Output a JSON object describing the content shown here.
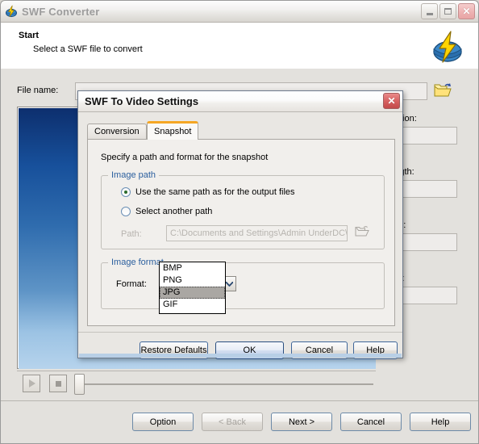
{
  "window": {
    "title": "SWF Converter",
    "icon": "app-lightning-icon",
    "controls": {
      "minimize": "–",
      "maximize": "□",
      "close": "✕"
    }
  },
  "header": {
    "title": "Start",
    "subtitle": "Select a SWF file to convert",
    "logo": "swf-converter-logo"
  },
  "main": {
    "file_name_label": "File name:",
    "file_name_value": "",
    "browse_icon": "open-folder-icon",
    "fields": [
      {
        "label": "Version:",
        "value": ""
      },
      {
        "label": "Length:",
        "value": ""
      },
      {
        "label": "Rate:",
        "value": ""
      },
      {
        "label": "Size:",
        "value": ""
      }
    ],
    "transport": {
      "play": "play-icon",
      "stop": "stop-icon",
      "seek_position": 0
    }
  },
  "footer": {
    "buttons": [
      {
        "label": "Option",
        "accesskey": "O",
        "disabled": false
      },
      {
        "label": "< Back",
        "accesskey": "B",
        "disabled": true
      },
      {
        "label": "Next >",
        "accesskey": "N",
        "disabled": false
      },
      {
        "label": "Cancel",
        "accesskey": "",
        "disabled": false
      },
      {
        "label": "Help",
        "accesskey": "",
        "disabled": false
      }
    ]
  },
  "dialog": {
    "title": "SWF To Video Settings",
    "close_glyph": "✕",
    "tabs": [
      {
        "label": "Conversion",
        "active": false
      },
      {
        "label": "Snapshot",
        "active": true
      }
    ],
    "note": "Specify a path and format for the snapshot",
    "image_path_group": {
      "legend": "Image path",
      "options": [
        {
          "label": "Use the same path as for the output files",
          "selected": true
        },
        {
          "label": "Select another path",
          "selected": false
        }
      ],
      "path_label": "Path:",
      "path_value": "C:\\Documents and Settings\\Admin UnderDC\\",
      "path_browse_icon": "open-folder-icon-disabled"
    },
    "image_format_group": {
      "legend": "Image format",
      "format_label": "Format:",
      "format_value": "JPG",
      "dropdown_open": true,
      "dropdown_arrow_icon": "chevron-down-icon",
      "options": [
        "BMP",
        "PNG",
        "JPG",
        "GIF"
      ],
      "highlighted_option": "JPG"
    },
    "buttons": [
      {
        "label": "Restore Defaults",
        "default": false
      },
      {
        "label": "OK",
        "default": true
      },
      {
        "label": "Cancel",
        "default": false
      },
      {
        "label": "Help",
        "default": false
      }
    ]
  },
  "colors": {
    "accent_tab": "#f5a623",
    "group_legend": "#2b5f9e",
    "dialog_default_button": "#bed0ea",
    "close_button": "#d55f5f",
    "preview_top": "#0d2f6e",
    "preview_bottom": "#b6d3ec"
  }
}
